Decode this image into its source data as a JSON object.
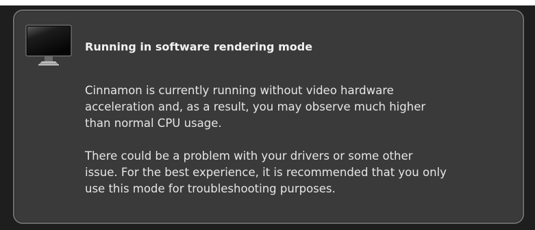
{
  "notification": {
    "icon": "monitor-icon",
    "title": "Running in software rendering mode",
    "paragraphs": [
      "Cinnamon is currently running without video hardware\nacceleration and, as a result, you may observe much higher\nthan normal CPU usage.",
      "There could be a problem with your drivers or some other\nissue.  For the best experience, it is recommended that you only\nuse this mode for troubleshooting purposes."
    ]
  },
  "colors": {
    "panel_background": "#3a3a3a",
    "panel_border": "#6e6e6e",
    "backdrop": "#1e1e1e",
    "text": "#e6e6e6"
  }
}
